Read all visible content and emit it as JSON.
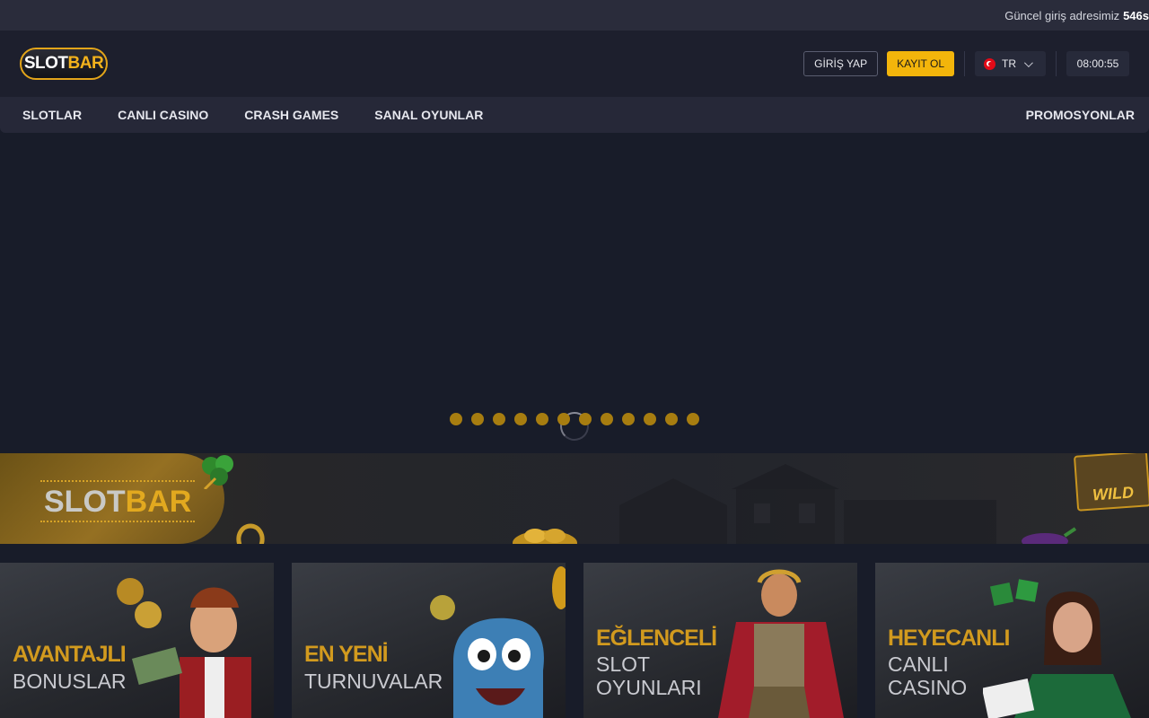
{
  "ticker": {
    "text": "Güncel giriş adresimiz",
    "count": "546s"
  },
  "header": {
    "logo": {
      "slot": "SLOT",
      "bar": "BAR"
    },
    "login_label": "GİRİŞ YAP",
    "register_label": "KAYIT OL",
    "language": "TR",
    "clock": "08:00:55"
  },
  "nav": {
    "items": [
      {
        "label": "SLOTLAR"
      },
      {
        "label": "CANLI CASINO"
      },
      {
        "label": "CRASH GAMES"
      },
      {
        "label": "SANAL OYUNLAR"
      }
    ],
    "promo_label": "PROMOSYONLAR"
  },
  "slider": {
    "dot_count": 12,
    "dot_color": "#a77d10"
  },
  "banner": {
    "logo": {
      "slot": "SLOT",
      "bar": "BAR"
    },
    "wild_label": "WILD"
  },
  "cards": [
    {
      "line1": "AVANTAJLI",
      "line2": "BONUSLAR"
    },
    {
      "line1": "EN YENİ",
      "line2": "TURNUVALAR"
    },
    {
      "line1": "EĞLENCELİ",
      "line2": "SLOT",
      "line3": "OYUNLARI"
    },
    {
      "line1": "HEYECANLI",
      "line2": "CANLI",
      "line3": "CASINO"
    }
  ],
  "colors": {
    "accent": "#f3b50b",
    "background": "#181c29",
    "nav_bg": "#262838",
    "header_bg": "#1d1f2d"
  }
}
